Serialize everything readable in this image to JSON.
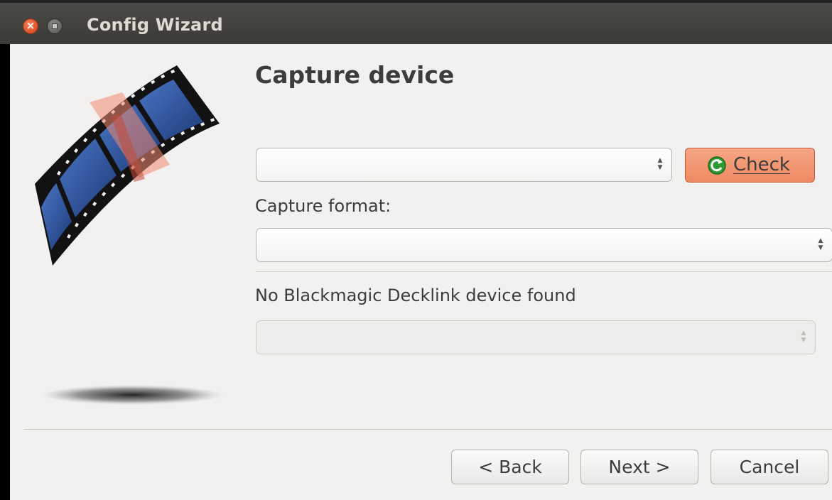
{
  "window": {
    "title": "Config Wizard",
    "close_glyph": "×"
  },
  "page": {
    "title": "Capture device"
  },
  "device": {
    "selected": "",
    "check_label": "Check",
    "check_icon": "refresh-icon"
  },
  "format": {
    "label": "Capture format:",
    "selected": ""
  },
  "decklink": {
    "status": "No Blackmagic Decklink device found",
    "selected": ""
  },
  "nav": {
    "back": "< Back",
    "next": "Next >",
    "cancel": "Cancel"
  },
  "colors": {
    "accent_button": "#ef8a62",
    "window_bg": "#f2f1f0",
    "titlebar": "#3b3a37"
  }
}
